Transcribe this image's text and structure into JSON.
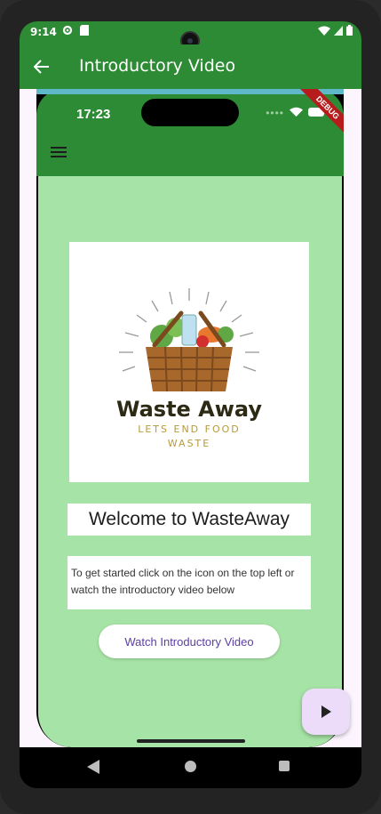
{
  "status_bar": {
    "time": "9:14"
  },
  "app_bar": {
    "title": "Introductory Video"
  },
  "inner_screen": {
    "time": "17:23",
    "debug_label": "DEBUG",
    "logo": {
      "title": "Waste Away",
      "tagline_1": "LETS END FOOD",
      "tagline_2": "WASTE"
    },
    "welcome_text": "Welcome to WasteAway",
    "description": "To get started click on the icon on the top left or watch the introductory video below",
    "watch_button": "Watch Introductory Video"
  },
  "colors": {
    "app_bar": "#2e8b35",
    "body_bg": "#a6e3a6",
    "button_text": "#5b3fa3",
    "fab_bg": "#ecdcfa"
  },
  "icons": {
    "back": "arrow-left-icon",
    "menu": "hamburger-menu-icon",
    "fab": "play-icon"
  }
}
